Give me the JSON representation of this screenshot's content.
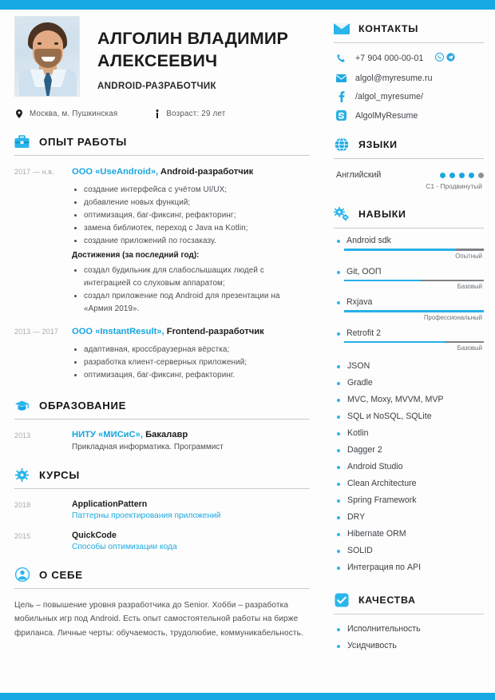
{
  "theme": {
    "accent": "#16a9e4",
    "accent_text": "#18a5e0",
    "rule": "#c9cbcd",
    "muted": "#a4a8ac"
  },
  "header": {
    "name": "АЛГОЛИН ВЛАДИМИР АЛЕКСЕЕВИЧ",
    "role": "ANDROID-РАЗРАБОТЧИК",
    "location": "Москва, м. Пушкинская",
    "age": "Возраст: 29 лет",
    "location_icon": "map-pin-icon",
    "age_icon": "info-icon"
  },
  "left": {
    "experience": {
      "title": "ОПЫТ РАБОТЫ",
      "icon": "briefcase-icon",
      "entries": [
        {
          "dates": "2017 — н.в.",
          "company": "ООО «UseAndroid»,",
          "position": " Android-разработчик",
          "bullets": [
            "создание интерфейса с учётом UI/UX;",
            "добавление новых функций;",
            "оптимизация, баг-фиксинг, рефакторинг;",
            "замена библиотек, переход с Java на Kotlin;",
            "создание приложений по госзаказу."
          ],
          "achievements_label": "Достижения (за последний год):",
          "achievements": [
            "создал будильник для слабослышащих людей с интеграцией со слуховым аппаратом;",
            "создал приложение под Android для презентации на «Армия 2019»."
          ]
        },
        {
          "dates": "2013 — 2017",
          "company": "ООО «InstantResult»,",
          "position": " Frontend-разработчик",
          "bullets": [
            "адаптивная, кроссбраузерная вёрстка;",
            "разработка клиент-серверных приложений;",
            "оптимизация, баг-фиксинг, рефакторинг."
          ],
          "achievements_label": "",
          "achievements": []
        }
      ]
    },
    "education": {
      "title": "ОБРАЗОВАНИЕ",
      "icon": "graduation-cap-icon",
      "entries": [
        {
          "dates": "2013",
          "school": "НИТУ «МИСиС»,",
          "degree": " Бакалавр",
          "subtitle": "Прикладная информатика. Программист"
        }
      ]
    },
    "courses": {
      "title": "КУРСЫ",
      "icon": "gear-icon",
      "entries": [
        {
          "dates": "2018",
          "name": "ApplicationPattern",
          "subtitle": "Паттерны проектирования приложений"
        },
        {
          "dates": "2015",
          "name": "QuickCode",
          "subtitle": "Способы оптимизации кода"
        }
      ]
    },
    "about": {
      "title": "О СЕБЕ",
      "icon": "user-circle-icon",
      "text": "Цель – повышение уровня разработчика до Senior. Хобби – разработка мобильных игр под Android. Есть опыт самостоятельной работы на бирже фриланса. Личные черты: обучаемость, трудолюбие, коммуникабельность."
    }
  },
  "right": {
    "contacts": {
      "title": "КОНТАКТЫ",
      "icon": "envelope-icon",
      "items": [
        {
          "icon": "phone-icon",
          "value": "+7 904 000-00-01",
          "badges": [
            "whatsapp-icon",
            "telegram-icon"
          ]
        },
        {
          "icon": "mail-icon",
          "value": "algol@myresume.ru",
          "badges": []
        },
        {
          "icon": "facebook-icon",
          "value": "/algol_myresume/",
          "badges": []
        },
        {
          "icon": "skype-icon",
          "value": "AlgolMyResume",
          "badges": []
        }
      ]
    },
    "languages": {
      "title": "ЯЗЫКИ",
      "icon": "globe-icon",
      "items": [
        {
          "name": "Английский",
          "dots_total": 5,
          "dots_filled": 4,
          "level": "C1 - Продвинутый"
        }
      ]
    },
    "skills": {
      "title": "НАВЫКИ",
      "icon": "gears-icon",
      "rated": [
        {
          "name": "Android sdk",
          "percent": 80,
          "level": "Опытный"
        },
        {
          "name": "Git, ООП",
          "percent": 55,
          "level": "Базовый"
        },
        {
          "name": "Rxjava",
          "percent": 100,
          "level": "Профессиональный"
        },
        {
          "name": "Retrofit 2",
          "percent": 72,
          "level": "Базовый"
        }
      ],
      "list": [
        "JSON",
        "Gradle",
        "MVC, Moxy, MVVM, MVP",
        "SQL и NoSQL, SQLite",
        "Kotlin",
        "Dagger 2",
        "Android Studio",
        "Clean Architecture",
        "Spring Framework",
        "DRY",
        "Hibernate ORM",
        "SOLID",
        "Интеграция по API"
      ]
    },
    "qualities": {
      "title": "КАЧЕСТВА",
      "icon": "check-square-icon",
      "list": [
        "Исполнительность",
        "Усидчивость"
      ]
    }
  }
}
